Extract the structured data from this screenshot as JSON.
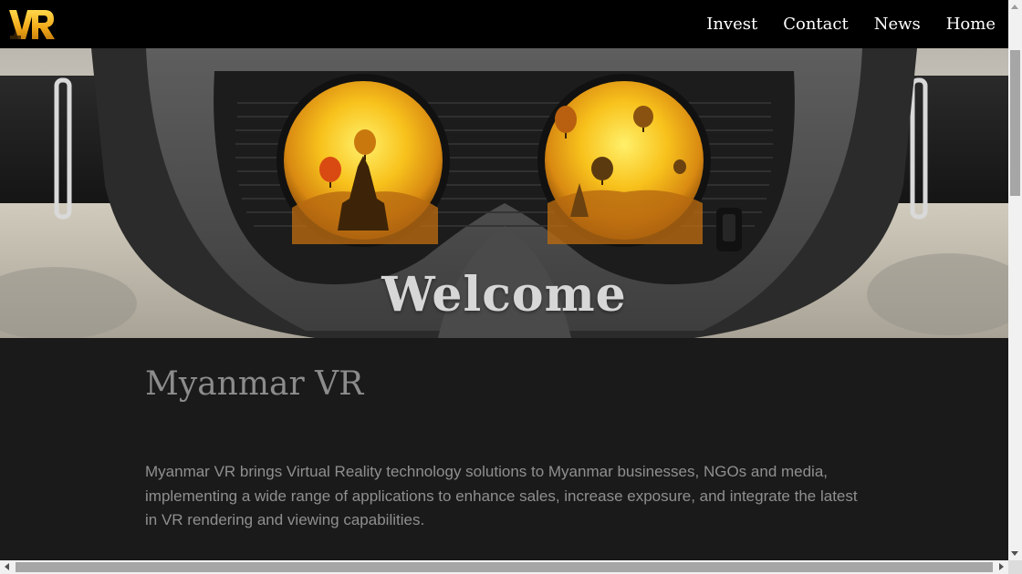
{
  "navbar": {
    "logo_text": "VR",
    "links": [
      {
        "label": "Invest"
      },
      {
        "label": "Contact"
      },
      {
        "label": "News"
      },
      {
        "label": "Home"
      }
    ]
  },
  "hero": {
    "title": "Welcome"
  },
  "main": {
    "site_name": "Myanmar VR",
    "intro": "Myanmar VR brings Virtual Reality technology solutions to Myanmar businesses, NGOs and media, implementing a wide range of applications to enhance sales, increase exposure, and integrate the latest in VR rendering and viewing capabilities."
  },
  "colors": {
    "navbar_bg": "#000000",
    "content_bg": "#1a1a1a",
    "logo_gold": "#f2b31d",
    "lens_yellow": "#f6c21a"
  }
}
